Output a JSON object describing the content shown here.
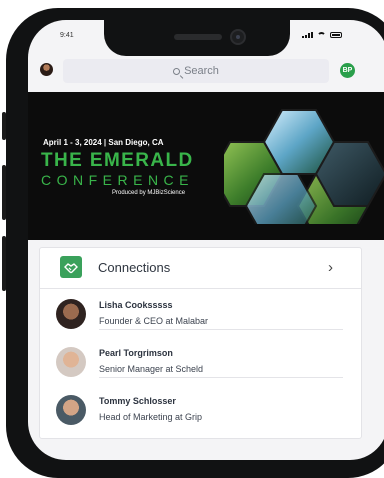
{
  "status_bar": {
    "time": "9:41"
  },
  "search": {
    "placeholder": "Search"
  },
  "profile": {
    "initials": "BP"
  },
  "banner": {
    "date_location": "April 1 - 3, 2024  |  San Diego, CA",
    "title": "THE EMERALD",
    "subtitle": "CONFERENCE",
    "produced_by": "Produced by MJBizScience"
  },
  "connections": {
    "title": "Connections",
    "people": [
      {
        "name": "Lisha Cooksssss",
        "role": "Founder & CEO at Malabar"
      },
      {
        "name": "Pearl Torgrimson",
        "role": "Senior Manager at Scheld"
      },
      {
        "name": "Tommy Schlosser",
        "role": "Head of Marketing at Grip"
      }
    ]
  },
  "colors": {
    "accent_green": "#39b54a",
    "badge_green": "#2a9f4b",
    "banner_bg": "#0c0c0c"
  }
}
